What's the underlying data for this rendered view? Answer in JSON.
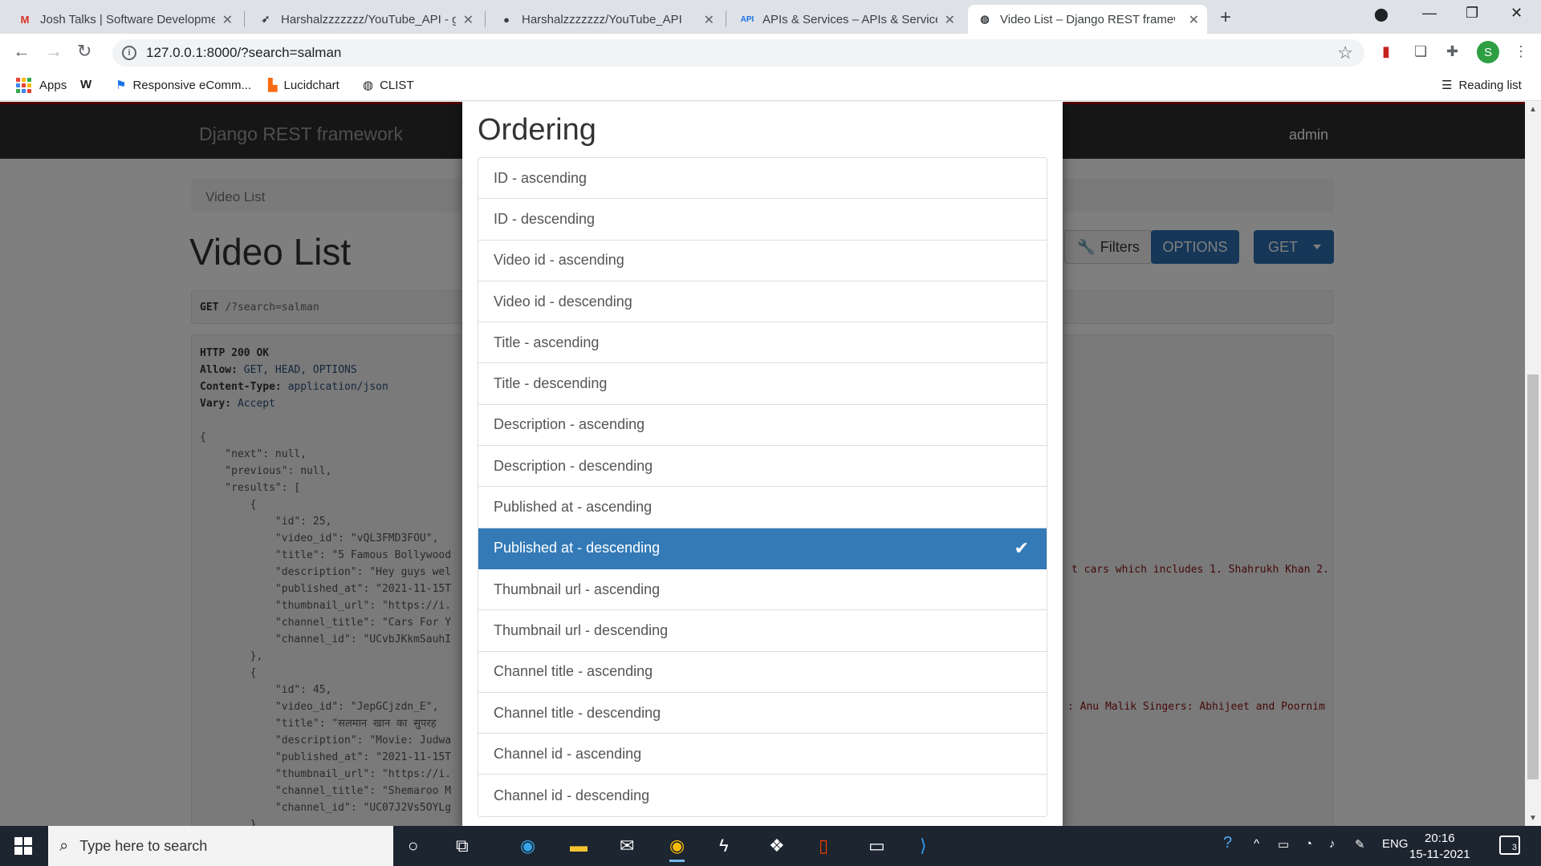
{
  "browser": {
    "tabs": [
      {
        "title": "Josh Talks | Software Developmen",
        "favicon": "gmail-icon"
      },
      {
        "title": "Harshalzzzzzzz/YouTube_API - git",
        "favicon": "send-icon"
      },
      {
        "title": "Harshalzzzzzzz/YouTube_API",
        "favicon": "github-icon"
      },
      {
        "title": "APIs & Services – APIs & Services",
        "favicon": "api-icon"
      },
      {
        "title": "Video List – Django REST framew",
        "favicon": "globe-icon",
        "active": true
      }
    ],
    "url": "127.0.0.1:8000/?search=salman",
    "profile_initial": "S",
    "bookmarks": [
      "Apps",
      "Responsive eComm...",
      "Lucidchart",
      "CLIST"
    ],
    "reading_list": "Reading list"
  },
  "page": {
    "brand": "Django REST framework",
    "user": "admin",
    "breadcrumb": "Video List",
    "title": "Video List",
    "buttons": {
      "filters": "Filters",
      "options": "OPTIONS",
      "get": "GET"
    },
    "request": {
      "method": "GET",
      "path": "/?search=salman"
    },
    "response_headers": {
      "status": "HTTP 200 OK",
      "allow_label": "Allow:",
      "allow_value": "GET, HEAD, OPTIONS",
      "ctype_label": "Content-Type:",
      "ctype_value": "application/json",
      "vary_label": "Vary:",
      "vary_value": "Accept"
    },
    "json_lines": [
      "{",
      "    \"next\": null,",
      "    \"previous\": null,",
      "    \"results\": [",
      "        {",
      "            \"id\": 25,",
      "            \"video_id\": \"vQL3FMD3FOU\",",
      "            \"title\": \"5 Famous Bollywood",
      "            \"description\": \"Hey guys wel",
      "            \"published_at\": \"2021-11-15T",
      "            \"thumbnail_url\": \"https://i.",
      "            \"channel_title\": \"Cars For Y",
      "            \"channel_id\": \"UCvbJKkmSauhI",
      "        },",
      "        {",
      "            \"id\": 45,",
      "            \"video_id\": \"JepGCjzdn_E\",",
      "            \"title\": \"सलमान खान का सुपरह",
      "            \"description\": \"Movie: Judwa",
      "            \"published_at\": \"2021-11-15T",
      "            \"thumbnail_url\": \"https://i.",
      "            \"channel_title\": \"Shemaroo M",
      "            \"channel_id\": \"UC07J2Vs5OYLg",
      "        }"
    ],
    "desc_tail_1": "t cars which includes 1. Shahrukh Khan 2.",
    "desc_tail_2": ": Anu Malik Singers: Abhijeet and Poornim"
  },
  "modal": {
    "title": "Ordering",
    "items": [
      "ID - ascending",
      "ID - descending",
      "Video id - ascending",
      "Video id - descending",
      "Title - ascending",
      "Title - descending",
      "Description - ascending",
      "Description - descending",
      "Published at - ascending",
      "Published at - descending",
      "Thumbnail url - ascending",
      "Thumbnail url - descending",
      "Channel title - ascending",
      "Channel title - descending",
      "Channel id - ascending",
      "Channel id - descending"
    ],
    "selected": "Published at - descending"
  },
  "taskbar": {
    "search_placeholder": "Type here to search",
    "language": "ENG",
    "time": "20:16",
    "date": "15-11-2021",
    "notifications": "3"
  },
  "colors": {
    "accent": "#337ab7",
    "navbar": "#2c2c2c",
    "navbar_top": "#a30000"
  }
}
